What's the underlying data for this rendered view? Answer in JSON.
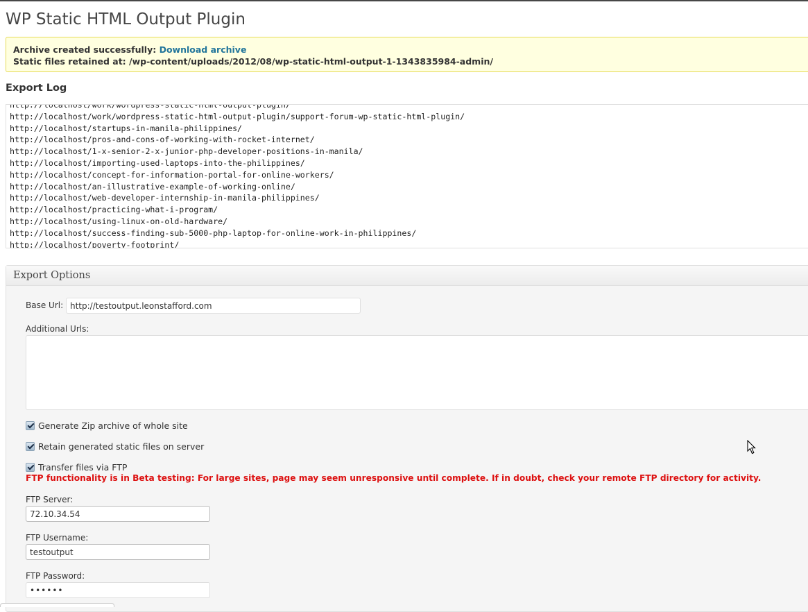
{
  "page": {
    "title": "WP Static HTML Output Plugin"
  },
  "notice": {
    "archive_label": "Archive created successfully:",
    "download_link": "Download archive",
    "retained_label": "Static files retained at:",
    "retained_path": "/wp-content/uploads/2012/08/wp-static-html-output-1-1343835984-admin/"
  },
  "export_log": {
    "heading": "Export Log",
    "lines": [
      "http://localhost/work/wordpress-static-html-output-plugin/",
      "http://localhost/work/wordpress-static-html-output-plugin/support-forum-wp-static-html-plugin/",
      "http://localhost/startups-in-manila-philippines/",
      "http://localhost/pros-and-cons-of-working-with-rocket-internet/",
      "http://localhost/1-x-senior-2-x-junior-php-developer-positions-in-manila/",
      "http://localhost/importing-used-laptops-into-the-philippines/",
      "http://localhost/concept-for-information-portal-for-online-workers/",
      "http://localhost/an-illustrative-example-of-working-online/",
      "http://localhost/web-developer-internship-in-manila-philippines/",
      "http://localhost/practicing-what-i-program/",
      "http://localhost/using-linux-on-old-hardware/",
      "http://localhost/success-finding-sub-5000-php-laptop-for-online-work-in-philippines/",
      "http://localhost/poverty-footprint/"
    ]
  },
  "export_options": {
    "heading": "Export Options",
    "base_url_label": "Base Url:",
    "base_url_value": "http://testoutput.leonstafford.com",
    "additional_urls_label": "Additional Urls:",
    "additional_urls_value": "",
    "checkboxes": [
      {
        "label": "Generate Zip archive of whole site",
        "checked": true
      },
      {
        "label": "Retain generated static files on server",
        "checked": true
      },
      {
        "label": "Transfer files via FTP",
        "checked": true
      }
    ],
    "ftp_warning": "FTP functionality is in Beta testing: For large sites, page may seem unresponsive until complete. If in doubt, check your remote FTP directory for activity.",
    "ftp_server_label": "FTP Server:",
    "ftp_server_value": "72.10.34.54",
    "ftp_username_label": "FTP Username:",
    "ftp_username_value": "testoutput",
    "ftp_password_label": "FTP Password:",
    "ftp_password_value": "••••••"
  },
  "colors": {
    "link": "#21759b",
    "warning": "#dd1111",
    "notice_bg": "#ffffe0",
    "notice_border": "#e6db55"
  }
}
